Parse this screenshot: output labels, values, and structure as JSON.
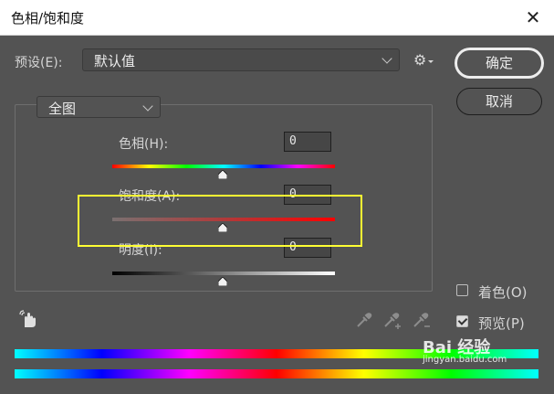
{
  "window": {
    "title": "色相/饱和度",
    "close_glyph": "✕"
  },
  "preset": {
    "label": "预设(E):",
    "value": "默认值"
  },
  "buttons": {
    "ok": "确定",
    "cancel": "取消"
  },
  "channel": {
    "value": "全图"
  },
  "sliders": [
    {
      "label": "色相(H):",
      "value": "0"
    },
    {
      "label": "饱和度(A):",
      "value": "0"
    },
    {
      "label": "明度(I):",
      "value": "0"
    }
  ],
  "options": {
    "colorize": {
      "label": "着色(O)",
      "checked": false
    },
    "preview": {
      "label": "预览(P)",
      "checked": true
    }
  },
  "watermark": {
    "brand": "Bai 经验",
    "url": "jingyan.baidu.com"
  },
  "icons": [
    "close-icon",
    "settings-gear-icon",
    "hand-target-icon",
    "eyedropper-icon",
    "eyedropper-plus-icon",
    "eyedropper-minus-icon"
  ]
}
